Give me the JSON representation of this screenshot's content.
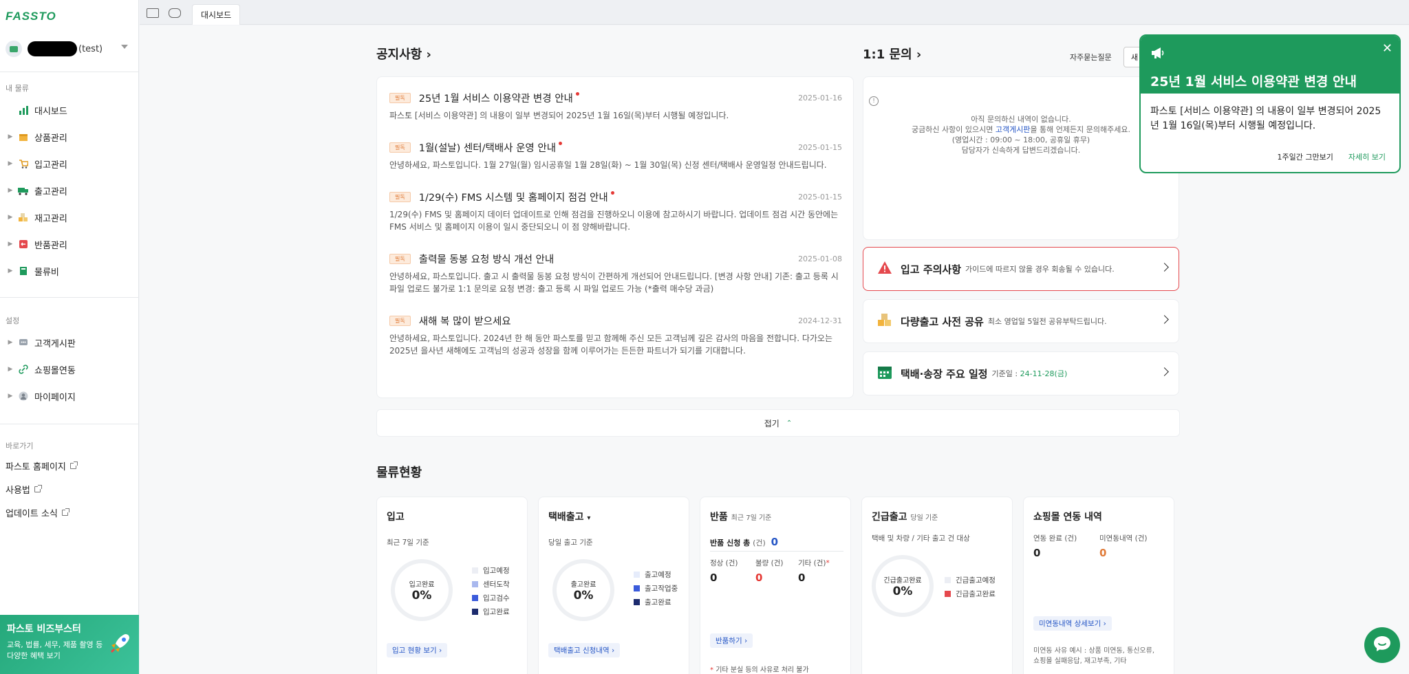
{
  "brand": {
    "logo": "FASSTO",
    "color": "#1e9a5c"
  },
  "store": {
    "name": "(test)"
  },
  "sidebar": {
    "section_my": "내 물류",
    "items": [
      {
        "label": "대시보드",
        "icon": "chart-icon"
      },
      {
        "label": "상품관리",
        "icon": "box-icon"
      },
      {
        "label": "입고관리",
        "icon": "cart-icon"
      },
      {
        "label": "출고관리",
        "icon": "truck-icon"
      },
      {
        "label": "재고관리",
        "icon": "stock-icon"
      },
      {
        "label": "반품관리",
        "icon": "return-icon"
      },
      {
        "label": "물류비",
        "icon": "book-icon"
      }
    ],
    "section_settings": "설정",
    "settings": [
      {
        "label": "고객게시판",
        "icon": "chat-icon"
      },
      {
        "label": "쇼핑몰연동",
        "icon": "link-icon"
      },
      {
        "label": "마이페이지",
        "icon": "user-icon"
      }
    ],
    "section_quick": "바로가기",
    "quick": [
      {
        "label": "파스토 홈페이지"
      },
      {
        "label": "사용법"
      },
      {
        "label": "업데이트 소식"
      }
    ],
    "banner": {
      "title": "파스토 비즈부스터",
      "line1": "교육, 법률, 세무, 제품 촬영 등",
      "line2": "다양한 혜택 보기"
    }
  },
  "topbar": {
    "tab": "대시보드"
  },
  "notices": {
    "title": "공지사항",
    "badge": "필독",
    "items": [
      {
        "title": "25년 1월 서비스 이용약관 변경 안내",
        "date": "2025-01-16",
        "body": "파스토 [서비스 이용약관] 의 내용이 일부 변경되어 2025년 1월 16일(목)부터 시행될 예정입니다."
      },
      {
        "title": "1월(설날) 센터/택배사 운영 안내",
        "date": "2025-01-15",
        "body": "안녕하세요, 파스토입니다. 1월 27일(월) 임시공휴일 1월 28일(화) ~ 1월 30일(목) 신정  센터/택배사 운영일정 안내드립니다."
      },
      {
        "title": "1/29(수) FMS 시스템 및 홈페이지 점검 안내",
        "date": "2025-01-15",
        "body": "1/29(수) FMS 및 홈페이지 데이터 업데이트로 인해 점검을 진행하오니 이용에 참고하시기 바랍니다. 업데이트 점검 시간 동안에는 FMS 서비스 및 홈페이지 이용이 일시 중단되오니 이 점 양해바랍니다."
      },
      {
        "title": "출력물 동봉 요청 방식 개선 안내",
        "date": "2025-01-08",
        "body": "안녕하세요, 파스토입니다. 출고 시 출력물 동봉 요청 방식이 간편하게 개선되어 안내드립니다. [변경 사항 안내] 기존: 출고 등록 시 파일 업로드 불가로 1:1 문의로 요청 변경: 출고 등록 시 파일 업로드 가능 (*출력 매수당 과금)"
      },
      {
        "title": "새해 복 많이 받으세요",
        "date": "2024-12-31",
        "body": "안녕하세요, 파스토입니다. 2024년 한 해 동안 파스토를 믿고 함께해 주신 모든 고객님께 깊은 감사의 마음을 전합니다. 다가오는 2025년 을사년 새해에도 고객님의 성공과 성장을 함께 이루어가는 든든한 파트너가 되기를 기대합니다."
      }
    ]
  },
  "inquiry": {
    "title": "1:1 문의",
    "faq": "자주묻는질문",
    "new_btn": "새",
    "empty1": "아직 문의하신 내역이 없습니다.",
    "empty2a": "궁금하신 사항이 있으시면 ",
    "empty2b": "고객게시판",
    "empty2c": "을 통해 언제든지 문의해주세요.",
    "empty3": "(영업시간 : 09:00 ~ 18:00, 공휴일 휴무)",
    "empty4": "담당자가 신속하게 답변드리겠습니다."
  },
  "info_cards": [
    {
      "title": "입고 주의사항",
      "sub": "가이드에 따르지 않을 경우 회송될 수 있습니다."
    },
    {
      "title": "다량출고 사전 공유",
      "sub": "최소 영업일 5일전 공유부탁드립니다."
    },
    {
      "title": "택배·송장 주요 일정",
      "sub": "기준일 : ",
      "date": "24-11-28(금)"
    }
  ],
  "collapse": {
    "label": "접기"
  },
  "logistics": {
    "title": "물류현황",
    "inbound": {
      "title": "입고",
      "sub": "최근 7일 기준",
      "ring_label": "입고완료",
      "ring_value": "0%",
      "legend": [
        "입고예정",
        "센터도착",
        "입고검수",
        "입고완료"
      ],
      "link": "입고 현황 보기"
    },
    "outbound": {
      "title": "택배출고",
      "sub": "당일 출고 기준",
      "ring_label": "출고완료",
      "ring_value": "0%",
      "legend": [
        "출고예정",
        "출고작업중",
        "출고완료"
      ],
      "link": "택배출고 신청내역"
    },
    "returns": {
      "title": "반품",
      "sub": "최근 7일 기준",
      "total_label": "반품 신청 총",
      "unit": "(건)",
      "total": "0",
      "normal": "정상",
      "bad": "불량",
      "etc": "기타",
      "normal_v": "0",
      "bad_v": "0",
      "etc_v": "0",
      "link": "반품하기",
      "note": "기타 분실 등의 사유로 처리 불가"
    },
    "urgent": {
      "title": "긴급출고",
      "sub": "당일 기준",
      "desc": "택배 및 차량 / 기타 출고 건 대상",
      "ring_label": "긴급출고완료",
      "ring_value": "0%",
      "legend": [
        "긴급출고예정",
        "긴급출고완료"
      ]
    },
    "mall": {
      "title": "쇼핑몰 연동 내역",
      "done": "연동 완료",
      "undone": "미연동내역",
      "unit": "(건)",
      "done_v": "0",
      "undone_v": "0",
      "link": "미연동내역 상세보기",
      "note1": "미연동 사유 예시 : 상품 미연동, 통신오류,",
      "note2": "쇼핑몰 실패응답, 재고부족, 기타"
    }
  },
  "popup": {
    "title": "25년 1월 서비스 이용약관 변경 안내",
    "body": "파스토 [서비스 이용약관] 의 내용이 일부 변경되어 2025년 1월 16일(목)부터 시행될 예정입니다.",
    "dismiss": "1주일간 그만보기",
    "more": "자세히 보기"
  }
}
